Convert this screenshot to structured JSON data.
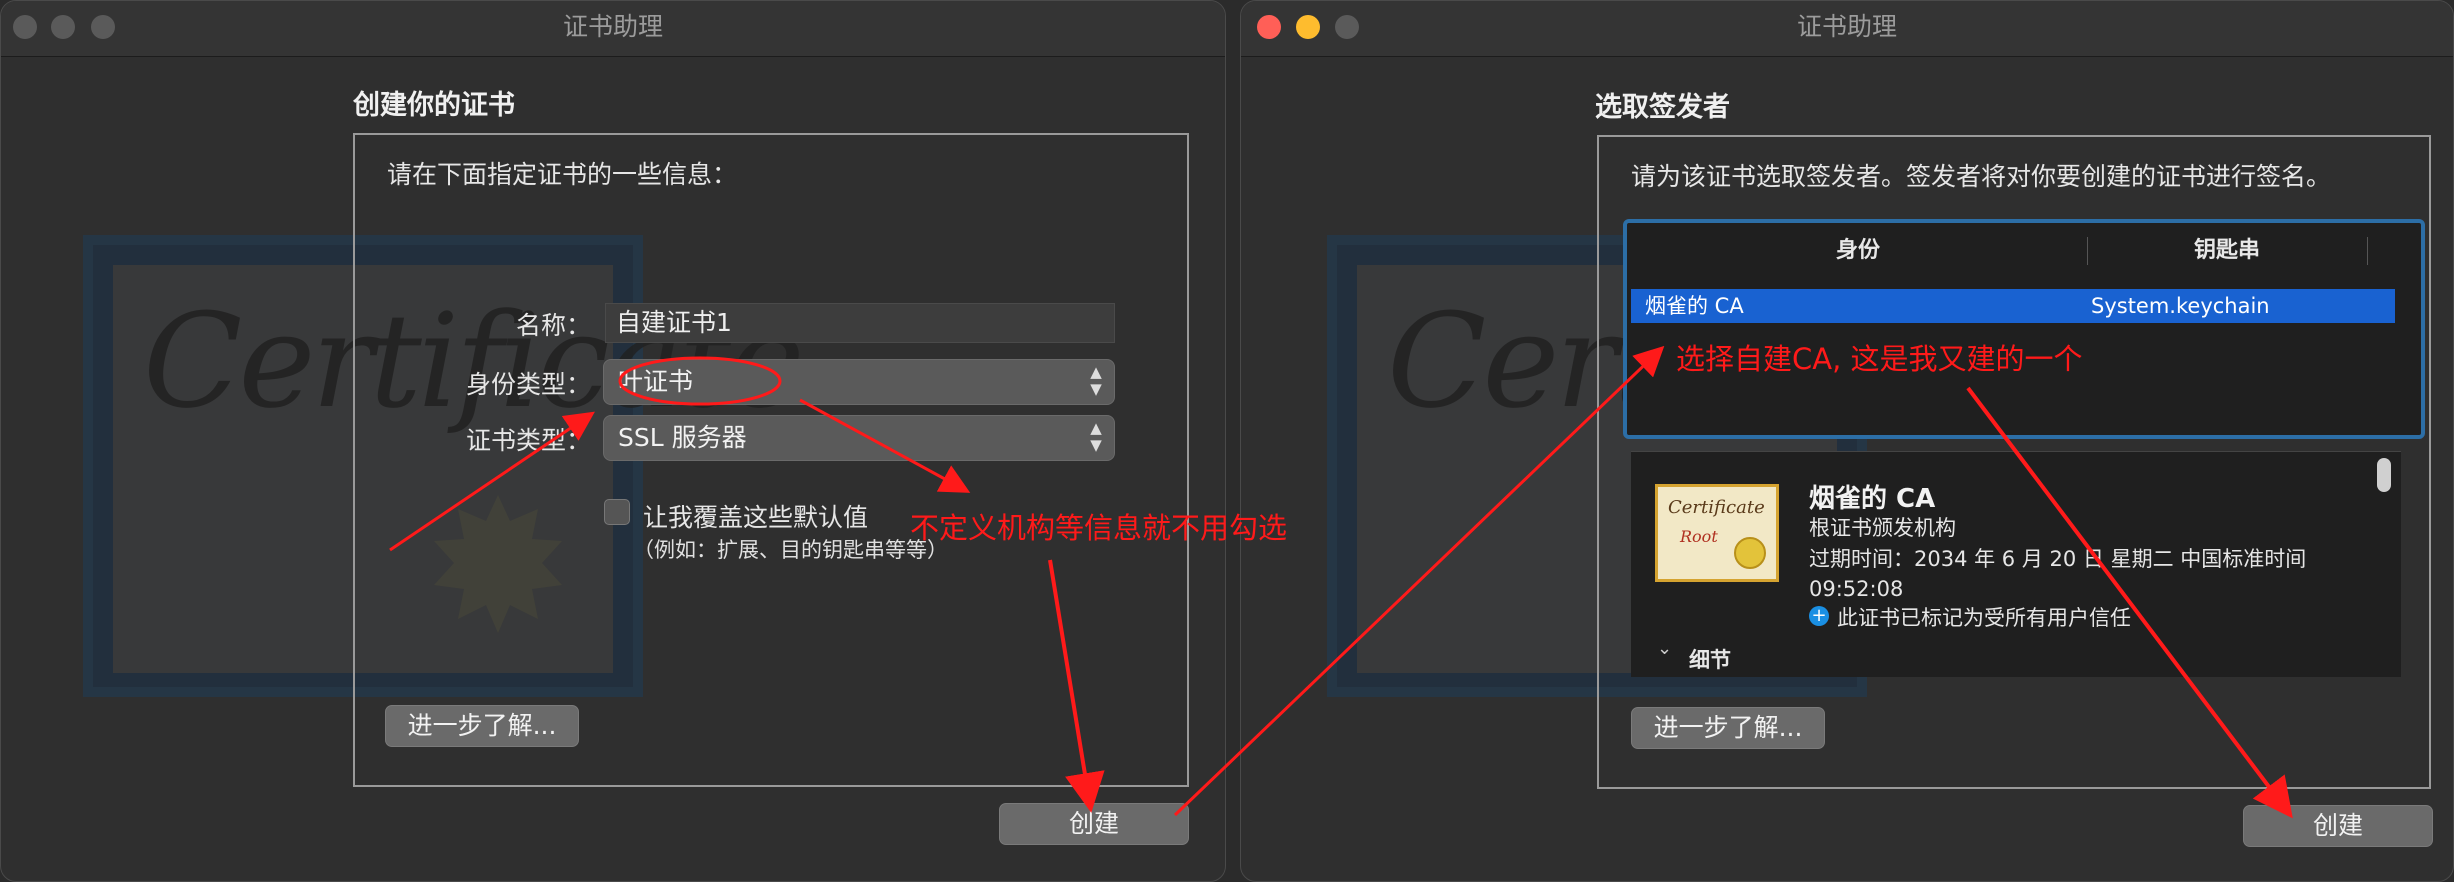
{
  "left_window": {
    "title": "证书助理",
    "section_title": "创建你的证书",
    "intro": "请在下面指定证书的一些信息：",
    "watermark_text": "Certificate",
    "name_label": "名称：",
    "name_value": "自建证书1",
    "identity_type_label": "身份类型：",
    "identity_type_value": "叶证书",
    "cert_type_label": "证书类型：",
    "cert_type_value": "SSL 服务器",
    "override_checkbox_label": "让我覆盖这些默认值",
    "override_checkbox_hint": "（例如：扩展、目的钥匙串等等）",
    "override_checked": false,
    "learn_more_button": "进一步了解...",
    "create_button": "创建"
  },
  "right_window": {
    "title": "证书助理",
    "section_title": "选取签发者",
    "intro": "请为该证书选取签发者。签发者将对你要创建的证书进行签名。",
    "watermark_text": "Certi",
    "table": {
      "columns": [
        "身份",
        "钥匙串"
      ],
      "rows": [
        {
          "identity": "烟雀的 CA",
          "keychain": "System.keychain",
          "selected": true
        }
      ]
    },
    "detail": {
      "icon_caption": "Certificate",
      "icon_sub": "Root",
      "name": "烟雀的 CA",
      "kind": "根证书颁发机构",
      "expiry": "过期时间：2034 年 6 月 20 日 星期二 中国标准时间 09:52:08",
      "trust": "此证书已标记为受所有用户信任",
      "details_label": "细节"
    },
    "learn_more_button": "进一步了解...",
    "create_button": "创建"
  },
  "annotations": {
    "left_note": "不定义机构等信息就不用勾选",
    "right_note": "选择自建CA, 这是我又建的一个"
  },
  "colors": {
    "annotation_red": "#ff1a1a",
    "selection_blue": "#1962d1",
    "focus_ring": "#2c6ea6",
    "traffic_close": "#ff5f57",
    "traffic_minimize": "#febc2e",
    "traffic_inactive": "#5a5a5a"
  }
}
